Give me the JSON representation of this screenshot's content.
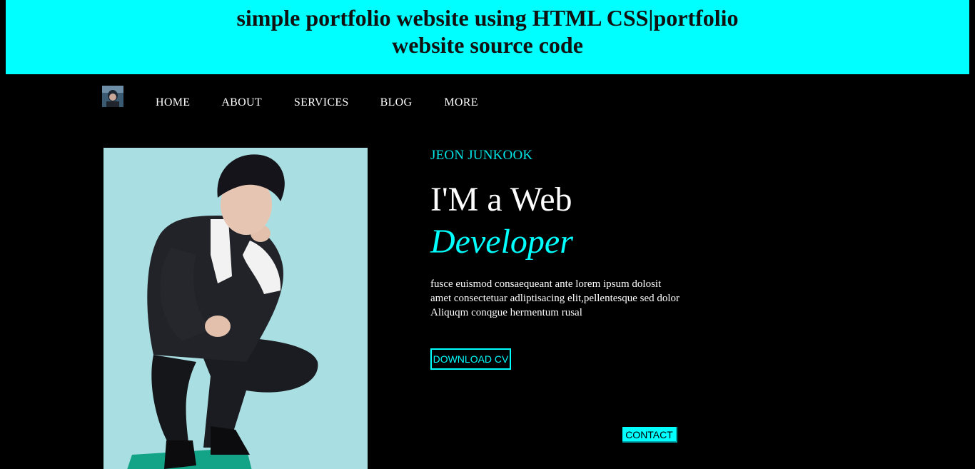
{
  "banner": {
    "title": "simple portfolio website using HTML CSS|portfolio website source code"
  },
  "nav": {
    "logo_icon": "avatar-thumbnail",
    "items": [
      {
        "label": "HOME"
      },
      {
        "label": "ABOUT"
      },
      {
        "label": "SERVICES"
      },
      {
        "label": "BLOG"
      },
      {
        "label": "MORE"
      }
    ]
  },
  "hero": {
    "name": "JEON JUNKOOK",
    "headline_line1": "I'M a Web",
    "headline_line2": "Developer",
    "description": "fusce euismod consaequeant ante lorem ipsum dolosit amet consectetuar adliptisacing elit,pellentesque sed dolor Aliquqm conqgue hermentum rusal",
    "download_label": "DOWNLOAD CV",
    "contact_label": "CONTACT",
    "photo": "portrait-photo"
  },
  "colors": {
    "accent": "#00ffff",
    "background": "#000000",
    "text": "#ffffff"
  }
}
